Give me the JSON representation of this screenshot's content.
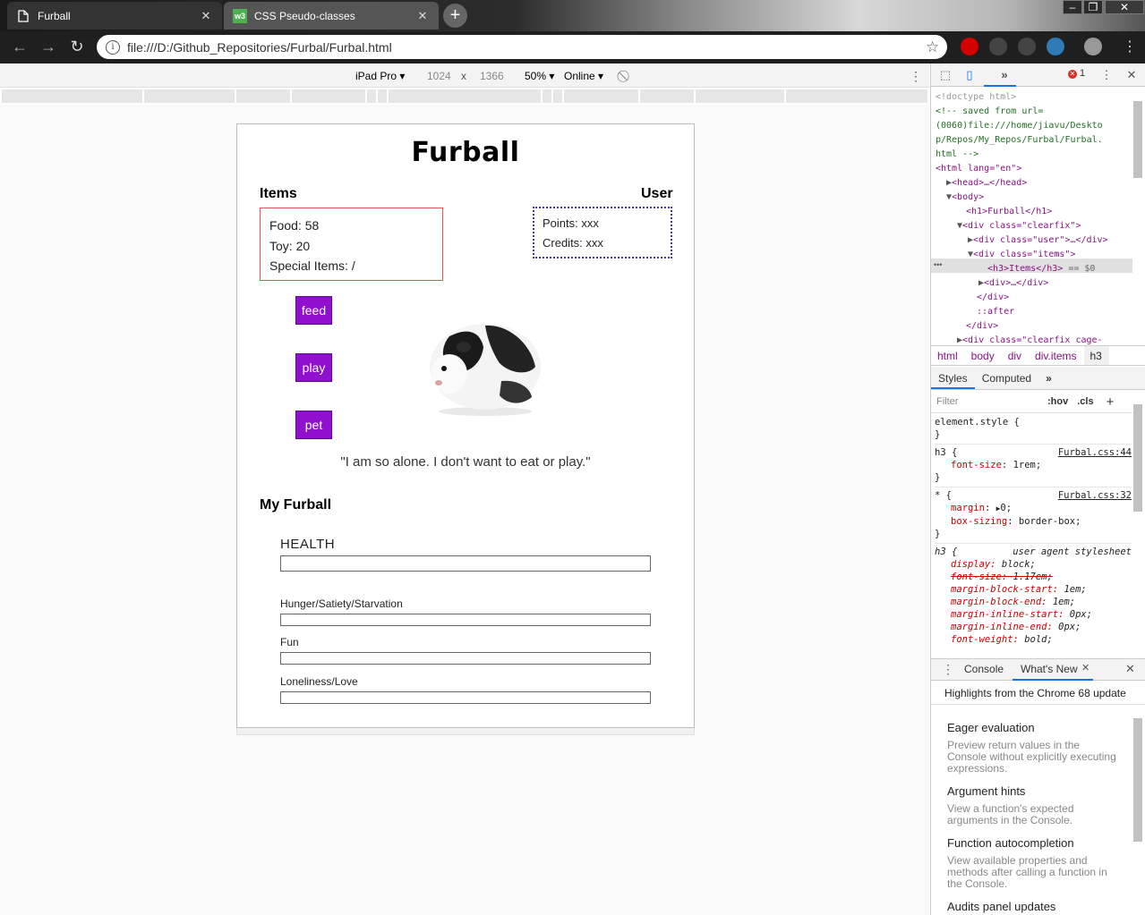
{
  "browser": {
    "tabs": [
      {
        "title": "Furball",
        "active": true
      },
      {
        "title": "CSS Pseudo-classes",
        "favicon_text": "w3",
        "active": false
      }
    ],
    "url": "file:///D:/Github_Repositories/Furbal/Furbal.html"
  },
  "device_toolbar": {
    "device": "iPad Pro",
    "width": "1024",
    "times": "x",
    "height": "1366",
    "zoom": "50%",
    "network": "Online"
  },
  "page": {
    "title": "Furball",
    "items_heading": "Items",
    "user_heading": "User",
    "items": [
      "Food: 58",
      "Toy: 20",
      "Special Items: /"
    ],
    "user": [
      "Points: xxx",
      "Credits: xxx"
    ],
    "buttons": {
      "feed": "feed",
      "play": "play",
      "pet": "pet"
    },
    "quote": "\"I am so alone. I don't want to eat or play.\"",
    "my_furball_heading": "My Furball",
    "health_label": "HEALTH",
    "bars": [
      {
        "label": "Hunger/Satiety/Starvation",
        "fill": 0
      },
      {
        "label": "Fun",
        "fill": 0
      },
      {
        "label": "Loneliness/Love",
        "fill": 0
      }
    ],
    "health_fill": 0
  },
  "devtools": {
    "error_count": "1",
    "dom": {
      "doctype": "<!doctype html>",
      "comment1": "<!-- saved from url=",
      "comment2": "(0060)file:///home/jiavu/Deskto",
      "comment3": "p/Repos/My_Repos/Furbal/Furbal.",
      "comment4": "html -->",
      "html_open": "<html lang=\"en\">",
      "head": "<head>…</head>",
      "body_open": "<body>",
      "h1": "<h1>Furball</h1>",
      "div_clearfix": "<div class=\"clearfix\">",
      "div_user": "<div class=\"user\">…</div>",
      "div_items": "<div class=\"items\">",
      "h3_selected": "<h3>Items</h3>",
      "h3_marker": "== $0",
      "div_inner": "<div>…</div>",
      "div_close1": "</div>",
      "after": "::after",
      "div_close2": "</div>",
      "div_cage": "<div class=\"clearfix cage-"
    },
    "breadcrumbs": [
      "html",
      "body",
      "div",
      "div.items",
      "h3"
    ],
    "styles_tabs": [
      "Styles",
      "Computed"
    ],
    "filter_placeholder": "Filter",
    "hov": ":hov",
    "cls": ".cls",
    "rules": {
      "element_style": "element.style {",
      "close": "}",
      "h3_selector": "h3 {",
      "h3_src": "Furbal.css:44",
      "h3_prop": "font-size",
      "h3_val": "1rem;",
      "star_selector": "* {",
      "star_src": "Furbal.css:32",
      "margin_prop": "margin",
      "margin_val": "0;",
      "boxsizing_prop": "box-sizing",
      "boxsizing_val": "border-box;",
      "ua_selector": "h3 {",
      "ua_src": "user agent stylesheet",
      "ua_lines": [
        {
          "p": "display",
          "v": "block;",
          "strike": false
        },
        {
          "p": "font-size",
          "v": "1.17em;",
          "strike": true
        },
        {
          "p": "margin-block-start",
          "v": "1em;",
          "strike": false
        },
        {
          "p": "margin-block-end",
          "v": "1em;",
          "strike": false
        },
        {
          "p": "margin-inline-start",
          "v": "0px;",
          "strike": false
        },
        {
          "p": "margin-inline-end",
          "v": "0px;",
          "strike": false
        },
        {
          "p": "font-weight",
          "v": "bold;",
          "strike": false
        }
      ]
    },
    "drawer_tabs": {
      "console": "Console",
      "whats_new": "What's New"
    },
    "whats_new_header": "Highlights from the Chrome 68 update",
    "whats_new": [
      {
        "title": "Eager evaluation",
        "desc": "Preview return values in the Console without explicitly executing expressions."
      },
      {
        "title": "Argument hints",
        "desc": "View a function's expected arguments in the Console."
      },
      {
        "title": "Function autocompletion",
        "desc": "View available properties and methods after calling a function in the Console."
      },
      {
        "title": "Audits panel updates",
        "desc": ""
      }
    ]
  },
  "colors": {
    "button_purple": "#9110cf",
    "items_border": "#e05656",
    "user_border": "#3a3aa0"
  }
}
